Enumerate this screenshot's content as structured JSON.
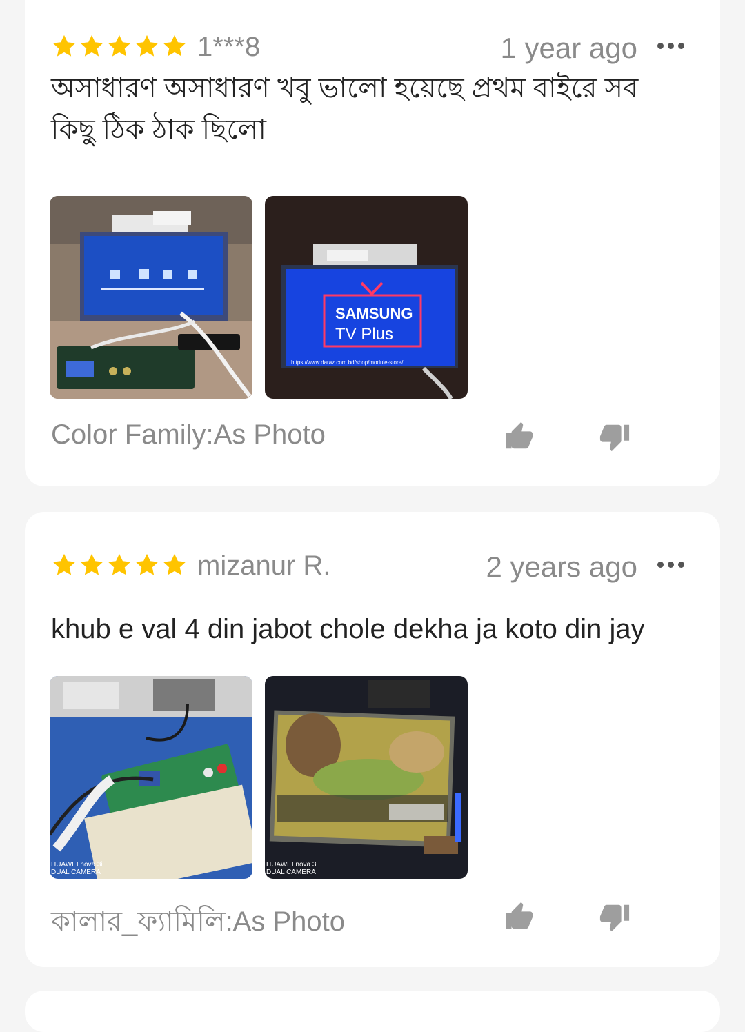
{
  "reviews": [
    {
      "rating": 5,
      "reviewer": "1***8",
      "time": "1 year ago",
      "text": "অসাধারণ অসাধারণ খবু ভালো হয়েছে প্রথম বাইরে সব কিছু ঠিক ঠাক ছিলো",
      "variant": "Color Family:As Photo",
      "photos": [
        {
          "screen_text": ""
        },
        {
          "screen_line1": "SAMSUNG",
          "screen_line2": "TV Plus",
          "screen_url": "https://www.daraz.com.bd/shop/module-store/"
        }
      ]
    },
    {
      "rating": 5,
      "reviewer": "mizanur R.",
      "time": "2 years ago",
      "text": "khub e val 4 din jabot chole dekha ja koto din jay",
      "variant": "কালার_ফ্যামিলি:As Photo",
      "photos": [
        {
          "camera_watermark_1": "HUAWEI nova 3i",
          "camera_watermark_2": "DUAL CAMERA"
        },
        {
          "camera_watermark_1": "HUAWEI nova 3i",
          "camera_watermark_2": "DUAL CAMERA"
        }
      ]
    }
  ],
  "colors": {
    "star": "#ffc400",
    "muted_text": "#8a8a8a",
    "body_text": "#222222",
    "icon_gray": "#9e9e9e",
    "card_bg": "#ffffff",
    "page_bg": "#f5f5f5"
  },
  "icons": [
    "star-icon",
    "more-icon",
    "thumbs-up-icon",
    "thumbs-down-icon"
  ]
}
